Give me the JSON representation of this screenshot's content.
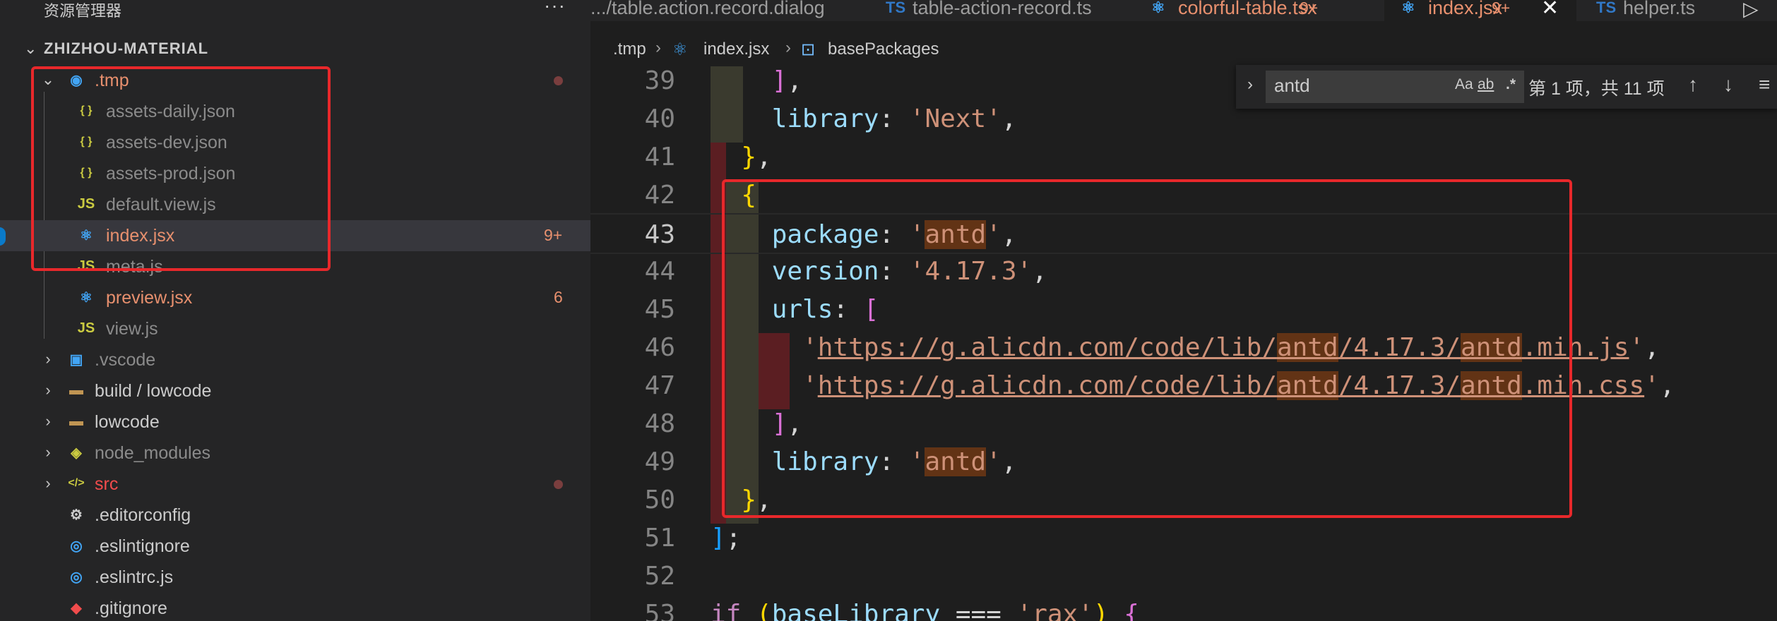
{
  "sidebar": {
    "title": "资源管理器",
    "more": "···",
    "root": "ZHIZHOU-MATERIAL",
    "items": [
      {
        "label": ".tmp",
        "icon": "folder-tmp-icon",
        "glyph": "◉",
        "cls": "c-mod",
        "icls": "c-react",
        "chev": "⌄",
        "badge": "",
        "dot": true
      },
      {
        "label": "assets-daily.json",
        "icon": "json-icon",
        "glyph": "{ }",
        "cls": "c-dim",
        "icls": "c-json",
        "chev": "",
        "badge": "",
        "dot": false
      },
      {
        "label": "assets-dev.json",
        "icon": "json-icon",
        "glyph": "{ }",
        "cls": "c-dim",
        "icls": "c-json",
        "chev": "",
        "badge": "",
        "dot": false
      },
      {
        "label": "assets-prod.json",
        "icon": "json-icon",
        "glyph": "{ }",
        "cls": "c-dim",
        "icls": "c-json",
        "chev": "",
        "badge": "",
        "dot": false
      },
      {
        "label": "default.view.js",
        "icon": "js-icon",
        "glyph": "JS",
        "cls": "c-dim",
        "icls": "c-js",
        "chev": "",
        "badge": "",
        "dot": false
      },
      {
        "label": "index.jsx",
        "icon": "react-icon",
        "glyph": "⚛",
        "cls": "c-mod",
        "icls": "c-react",
        "chev": "",
        "badge": "9+",
        "dot": false
      },
      {
        "label": "meta.js",
        "icon": "js-icon",
        "glyph": "JS",
        "cls": "c-dim",
        "icls": "c-js",
        "chev": "",
        "badge": "",
        "dot": false
      },
      {
        "label": "preview.jsx",
        "icon": "react-icon",
        "glyph": "⚛",
        "cls": "c-mod",
        "icls": "c-react",
        "chev": "",
        "badge": "6",
        "dot": false
      },
      {
        "label": "view.js",
        "icon": "js-icon",
        "glyph": "JS",
        "cls": "c-dim",
        "icls": "c-js",
        "chev": "",
        "badge": "",
        "dot": false
      },
      {
        "label": ".vscode",
        "icon": "folder-vscode-icon",
        "glyph": "▣",
        "cls": "c-dim",
        "icls": "c-react",
        "chev": "›",
        "badge": "",
        "dot": false
      },
      {
        "label": "build / lowcode",
        "icon": "folder-icon",
        "glyph": "▬",
        "cls": "c-normal",
        "icls": "c-folder",
        "chev": "›",
        "badge": "",
        "dot": false
      },
      {
        "label": "lowcode",
        "icon": "folder-icon",
        "glyph": "▬",
        "cls": "c-normal",
        "icls": "c-folder",
        "chev": "›",
        "badge": "",
        "dot": false
      },
      {
        "label": "node_modules",
        "icon": "folder-node-icon",
        "glyph": "◈",
        "cls": "c-dim",
        "icls": "c-json",
        "chev": "›",
        "badge": "",
        "dot": false
      },
      {
        "label": "src",
        "icon": "folder-src-icon",
        "glyph": "</>",
        "cls": "c-red",
        "icls": "c-json",
        "chev": "›",
        "badge": "",
        "dot": true
      },
      {
        "label": ".editorconfig",
        "icon": "editorconfig-icon",
        "glyph": "⚙",
        "cls": "c-normal",
        "icls": "c-normal",
        "chev": "",
        "badge": "",
        "dot": false
      },
      {
        "label": ".eslintignore",
        "icon": "eslint-icon",
        "glyph": "◎",
        "cls": "c-normal",
        "icls": "c-react",
        "chev": "",
        "badge": "",
        "dot": false
      },
      {
        "label": ".eslintrc.js",
        "icon": "eslint-icon",
        "glyph": "◎",
        "cls": "c-normal",
        "icls": "c-react",
        "chev": "",
        "badge": "",
        "dot": false
      },
      {
        "label": ".gitignore",
        "icon": "git-icon",
        "glyph": "◆",
        "cls": "c-normal",
        "icls": "c-red",
        "chev": "",
        "badge": "",
        "dot": false
      }
    ]
  },
  "tabs": [
    {
      "label": ".../table.action.record.dialog",
      "icon": "",
      "badge": "",
      "active": false
    },
    {
      "label": "table-action-record.ts",
      "icon": "TS",
      "badge": "",
      "active": false
    },
    {
      "label": "colorful-table.tsx",
      "icon": "⚛",
      "badge": "9+",
      "active": false
    },
    {
      "label": "index.jsx",
      "icon": "⚛",
      "badge": "9+",
      "active": true
    },
    {
      "label": "helper.ts",
      "icon": "TS",
      "badge": "",
      "active": false
    }
  ],
  "tab_close": "✕",
  "run": "▷",
  "breadcrumb": {
    "folder": ".tmp",
    "file": "index.jsx",
    "symbol": "basePackages",
    "sep": "›"
  },
  "find": {
    "query": "antd",
    "match_case": "Aa",
    "whole_word": "ab",
    "regex": ".*",
    "count": "第 1 项，共 11 项",
    "prev": "↑",
    "next": "↓",
    "menu": "≡",
    "toggle": "›"
  },
  "code": {
    "current_line": 43,
    "lines": [
      {
        "n": "39",
        "t": "    ],"
      },
      {
        "n": "40",
        "t": "    library: 'Next',"
      },
      {
        "n": "41",
        "t": "  },"
      },
      {
        "n": "42",
        "t": "  {"
      },
      {
        "n": "43",
        "t": "    package: 'antd',"
      },
      {
        "n": "44",
        "t": "    version: '4.17.3',"
      },
      {
        "n": "45",
        "t": "    urls: ["
      },
      {
        "n": "46",
        "t": "      'https://g.alicdn.com/code/lib/antd/4.17.3/antd.min.js',"
      },
      {
        "n": "47",
        "t": "      'https://g.alicdn.com/code/lib/antd/4.17.3/antd.min.css',"
      },
      {
        "n": "48",
        "t": "    ],"
      },
      {
        "n": "49",
        "t": "    library: 'antd',"
      },
      {
        "n": "50",
        "t": "  },"
      },
      {
        "n": "51",
        "t": "];"
      },
      {
        "n": "52",
        "t": ""
      },
      {
        "n": "53",
        "t": "if (baseLibrary === 'rax') {"
      }
    ]
  }
}
